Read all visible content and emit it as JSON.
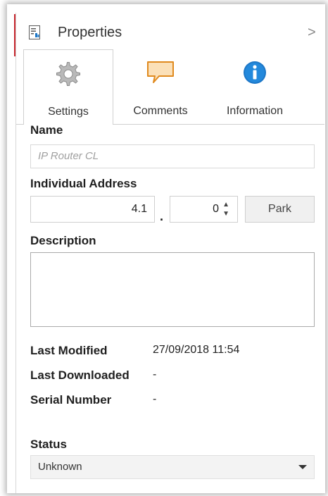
{
  "panel": {
    "title": "Properties",
    "collapse_glyph": ">"
  },
  "tabs": [
    {
      "label": "Settings",
      "icon": "gear-icon",
      "active": true
    },
    {
      "label": "Comments",
      "icon": "comment-icon",
      "active": false
    },
    {
      "label": "Information",
      "icon": "info-icon",
      "active": false
    }
  ],
  "settings": {
    "name_label": "Name",
    "name_value": "IP Router CL",
    "address_label": "Individual Address",
    "address_main": "4.1",
    "address_separator": ".",
    "address_device": "0",
    "park_label": "Park",
    "description_label": "Description",
    "description_value": "",
    "last_modified_label": "Last Modified",
    "last_modified_value": "27/09/2018 11:54",
    "last_downloaded_label": "Last Downloaded",
    "last_downloaded_value": "-",
    "serial_label": "Serial Number",
    "serial_value": "-",
    "status_label": "Status",
    "status_value": "Unknown"
  },
  "colors": {
    "accent": "#c8262e",
    "info_blue": "#1d77c7",
    "comment_fill": "#fbe0b8",
    "comment_stroke": "#e08a1e"
  }
}
